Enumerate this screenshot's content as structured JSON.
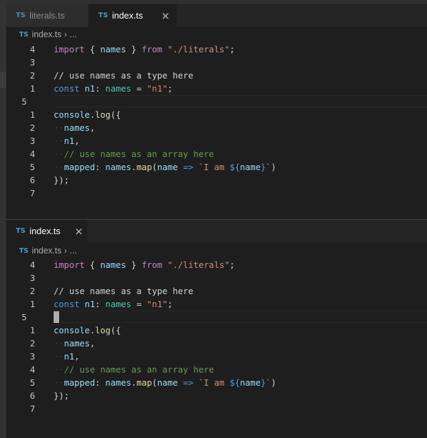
{
  "tabs_top": [
    {
      "icon": "TS",
      "label": "literals.ts",
      "active": false
    },
    {
      "icon": "TS",
      "label": "index.ts",
      "active": true,
      "close": "×"
    }
  ],
  "tabs_bottom": [
    {
      "icon": "TS",
      "label": "index.ts",
      "active": true,
      "close": "×"
    }
  ],
  "breadcrumb": {
    "icon": "TS",
    "file": "index.ts",
    "chevron": "›",
    "rest": "..."
  },
  "line_numbers": [
    "4",
    "3",
    "2",
    "1",
    "5",
    "1",
    "2",
    "3",
    "4",
    "5",
    "6",
    "7"
  ],
  "code": {
    "l1": {
      "a": "import",
      "b": " { ",
      "c": "names",
      "d": " } ",
      "e": "from",
      "f": " ",
      "g": "\"./literals\"",
      "h": ";"
    },
    "l2": {
      "a": ""
    },
    "l3": {
      "a": "// use names as a type here"
    },
    "l4": {
      "a": "const",
      "b": " ",
      "c": "n1",
      "d": ": ",
      "e": "names",
      "f": " = ",
      "g": "\"n1\"",
      "h": ";"
    },
    "l5": {
      "a": ""
    },
    "l6": {
      "a": "console",
      "b": ".",
      "c": "log",
      "d": "({"
    },
    "l7": {
      "a": "··",
      "b": "names",
      "c": ","
    },
    "l8": {
      "a": "··",
      "b": "n1",
      "c": ","
    },
    "l9": {
      "a": "··",
      "b": "// use names as an array here"
    },
    "l10": {
      "a": "··",
      "b": "mapped",
      "c": ": ",
      "d": "names",
      "e": ".",
      "f": "map",
      "g": "(",
      "h": "name",
      "i": " => ",
      "j": "`I am ",
      "k": "${",
      "l": "name",
      "m": "}",
      "n": "`",
      "o": ")"
    },
    "l11": {
      "a": "});"
    },
    "l12": {
      "a": ""
    }
  }
}
